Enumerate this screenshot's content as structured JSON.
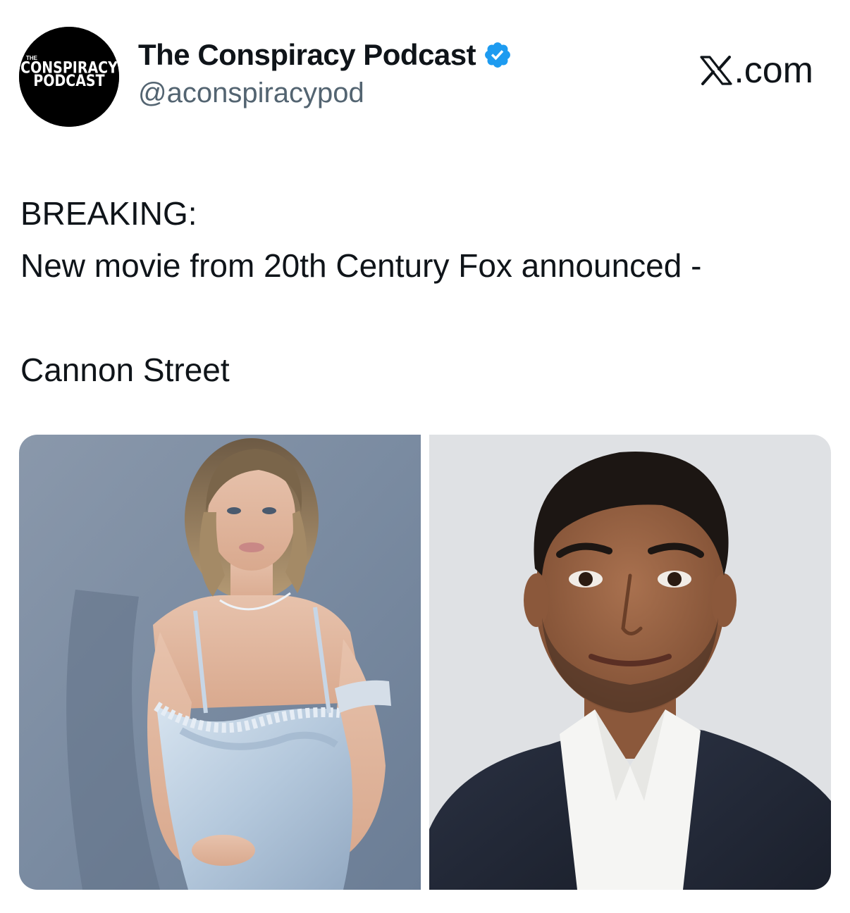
{
  "author": {
    "display_name": "The Conspiracy Podcast",
    "handle": "@aconspiracypod",
    "verified": true,
    "avatar": {
      "small_word": "THE",
      "line1": "CONSPIRACY",
      "line2": "PODCAST"
    }
  },
  "brand": {
    "icon": "x-logo-icon",
    "suffix": ".com"
  },
  "tweet": {
    "lines": [
      "BREAKING:",
      "New movie from 20th Century Fox announced -",
      "",
      "Cannon Street"
    ]
  },
  "media": {
    "count": 2,
    "images": [
      {
        "icon": "photo-woman-in-light-blue-gown"
      },
      {
        "icon": "photo-man-in-dark-blazer"
      }
    ]
  },
  "colors": {
    "text": "#0f1419",
    "secondary_text": "#536471",
    "verified_blue": "#1d9bf0"
  }
}
